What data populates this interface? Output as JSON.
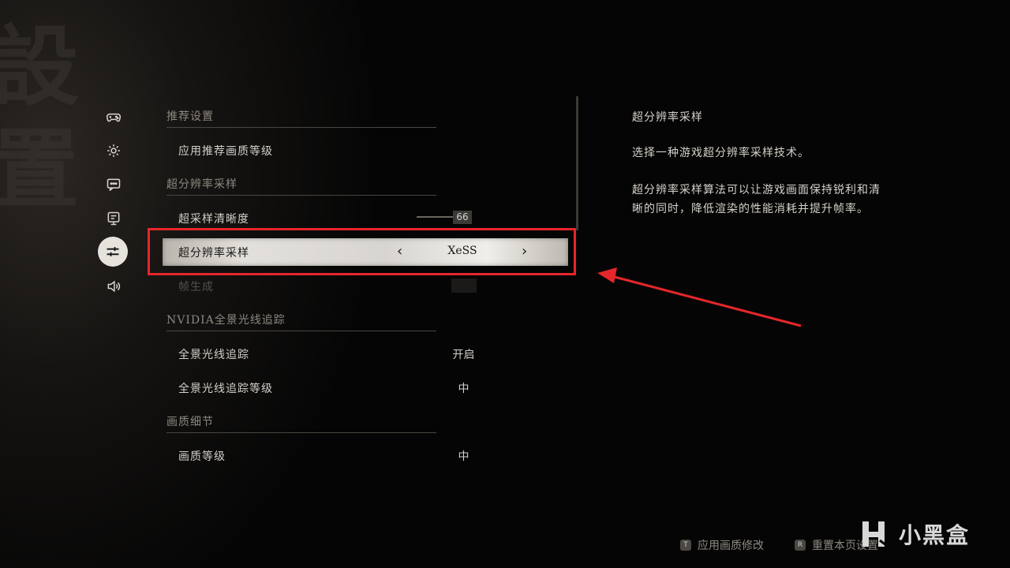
{
  "background": {
    "calligraphy": "設置"
  },
  "sidebar": {
    "icons": [
      {
        "name": "gamepad-icon",
        "active": false
      },
      {
        "name": "gear-icon",
        "active": false
      },
      {
        "name": "chat-icon",
        "active": false
      },
      {
        "name": "monitor-icon",
        "active": false
      },
      {
        "name": "sliders-icon",
        "active": true
      },
      {
        "name": "speaker-icon",
        "active": false
      }
    ]
  },
  "settings": {
    "section_recommended": "推荐设置",
    "apply_recommended": "应用推荐画质等级",
    "section_upscaling": "超分辨率采样",
    "upscale_sharpness": {
      "label": "超采样清晰度",
      "value": "66"
    },
    "upscaling": {
      "label": "超分辨率采样",
      "value": "XeSS",
      "prev": "‹",
      "next": "›"
    },
    "frame_gen": {
      "label": "帧生成"
    },
    "section_raytracing": "NVIDIA全景光线追踪",
    "raytracing": {
      "label": "全景光线追踪",
      "value": "开启"
    },
    "raytracing_level": {
      "label": "全景光线追踪等级",
      "value": "中"
    },
    "section_detail": "画质细节",
    "quality_level": {
      "label": "画质等级",
      "value": "中"
    }
  },
  "description": {
    "title": "超分辨率采样",
    "line1": "选择一种游戏超分辨率采样技术。",
    "line2": "超分辨率采样算法可以让游戏画面保持锐利和清",
    "line3": "晰的同时，降低渲染的性能消耗并提升帧率。"
  },
  "footer": {
    "apply": {
      "key": "T",
      "label": "应用画质修改"
    },
    "reset": {
      "key": "R",
      "label": "重置本页设置"
    }
  },
  "watermark": {
    "text": "小黑盒"
  },
  "colors": {
    "highlight": "#e5262b",
    "selected_bg": "#e3e0db"
  }
}
